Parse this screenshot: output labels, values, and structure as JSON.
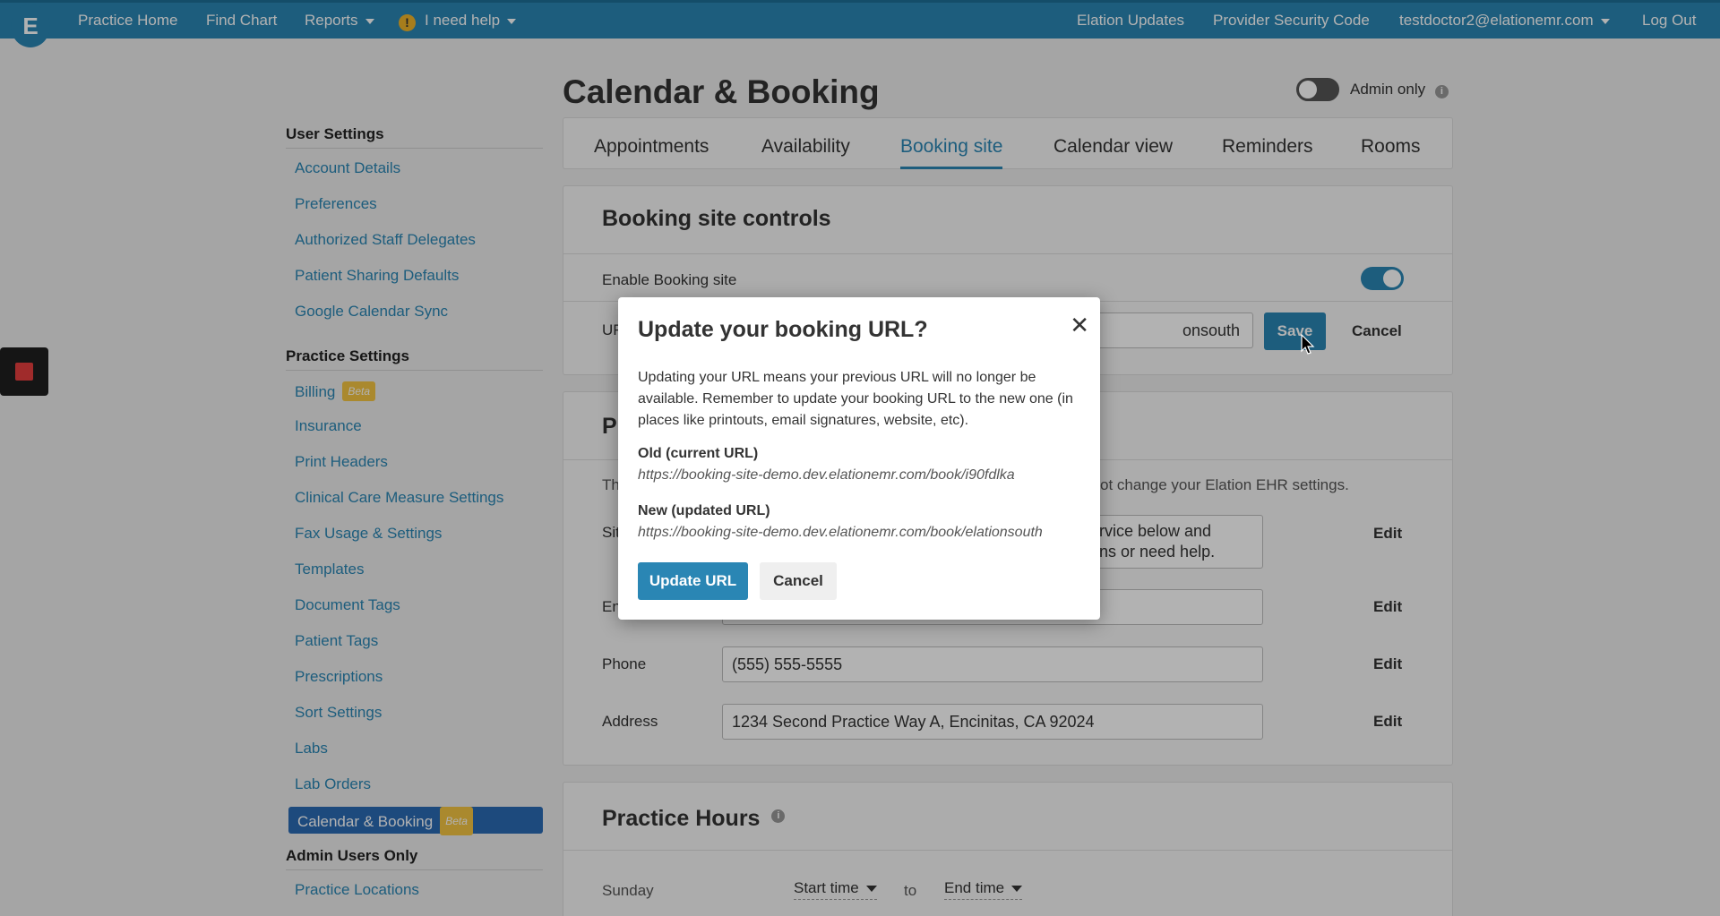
{
  "topnav": {
    "logo": "E",
    "items": [
      "Practice Home",
      "Find Chart",
      "Reports",
      "I need help"
    ],
    "right_items": [
      "Elation Updates",
      "Provider Security Code",
      "testdoctor2@elationemr.com",
      "Log Out"
    ]
  },
  "sidebar": {
    "user_settings_title": "User Settings",
    "user_settings": [
      "Account Details",
      "Preferences",
      "Authorized Staff Delegates",
      "Patient Sharing Defaults",
      "Google Calendar Sync"
    ],
    "practice_settings_title": "Practice Settings",
    "practice_settings": [
      "Billing",
      "Insurance",
      "Print Headers",
      "Clinical Care Measure Settings",
      "Fax Usage & Settings",
      "Templates",
      "Document Tags",
      "Patient Tags",
      "Prescriptions",
      "Sort Settings",
      "Labs",
      "Lab Orders",
      "Calendar & Booking"
    ],
    "beta_label": "Beta",
    "admin_title": "Admin Users Only",
    "admin_items": [
      "Practice Locations"
    ]
  },
  "main": {
    "title": "Calendar & Booking",
    "admin_only_label": "Admin only",
    "tabs": [
      "Appointments",
      "Availability",
      "Booking site",
      "Calendar view",
      "Reminders",
      "Rooms"
    ],
    "active_tab": "Booking site",
    "booking_controls": {
      "title": "Booking site controls",
      "enable_label": "Enable Booking site",
      "url_label_partial": "UF",
      "url_value_partial": "onsouth",
      "save_label": "Save",
      "cancel_label": "Cancel"
    },
    "info_card": {
      "title_partial": "P",
      "desc_partial_left": "Th",
      "desc_partial_right": "ot change your Elation EHR settings.",
      "site_label_partial": "Sit",
      "site_value_line1": "rvice below and",
      "site_value_line2": "ns or need help.",
      "email_label_partial": "En",
      "phone_label": "Phone",
      "phone_value": "(555) 555-5555",
      "address_label": "Address",
      "address_value": "1234 Second Practice Way A, Encinitas, CA 92024",
      "edit_label": "Edit"
    },
    "practice_hours": {
      "title": "Practice Hours",
      "day": "Sunday",
      "start_placeholder": "Start time",
      "to_label": "to",
      "end_placeholder": "End time"
    }
  },
  "modal": {
    "title": "Update your booking URL?",
    "body": "Updating your URL means your previous URL will no longer be available. Remember to update your booking URL to the new one (in places like printouts, email signatures, website, etc).",
    "old_label": "Old (current URL)",
    "old_url": "https://booking-site-demo.dev.elationemr.com/book/i90fdlka",
    "new_label": "New (updated URL)",
    "new_url": "https://booking-site-demo.dev.elationemr.com/book/elationsouth",
    "update_label": "Update URL",
    "cancel_label": "Cancel"
  },
  "colors": {
    "brand": "#2a86b4",
    "active_nav": "#2a6ab4",
    "beta": "#f4c542",
    "record": "#e53e3e"
  }
}
